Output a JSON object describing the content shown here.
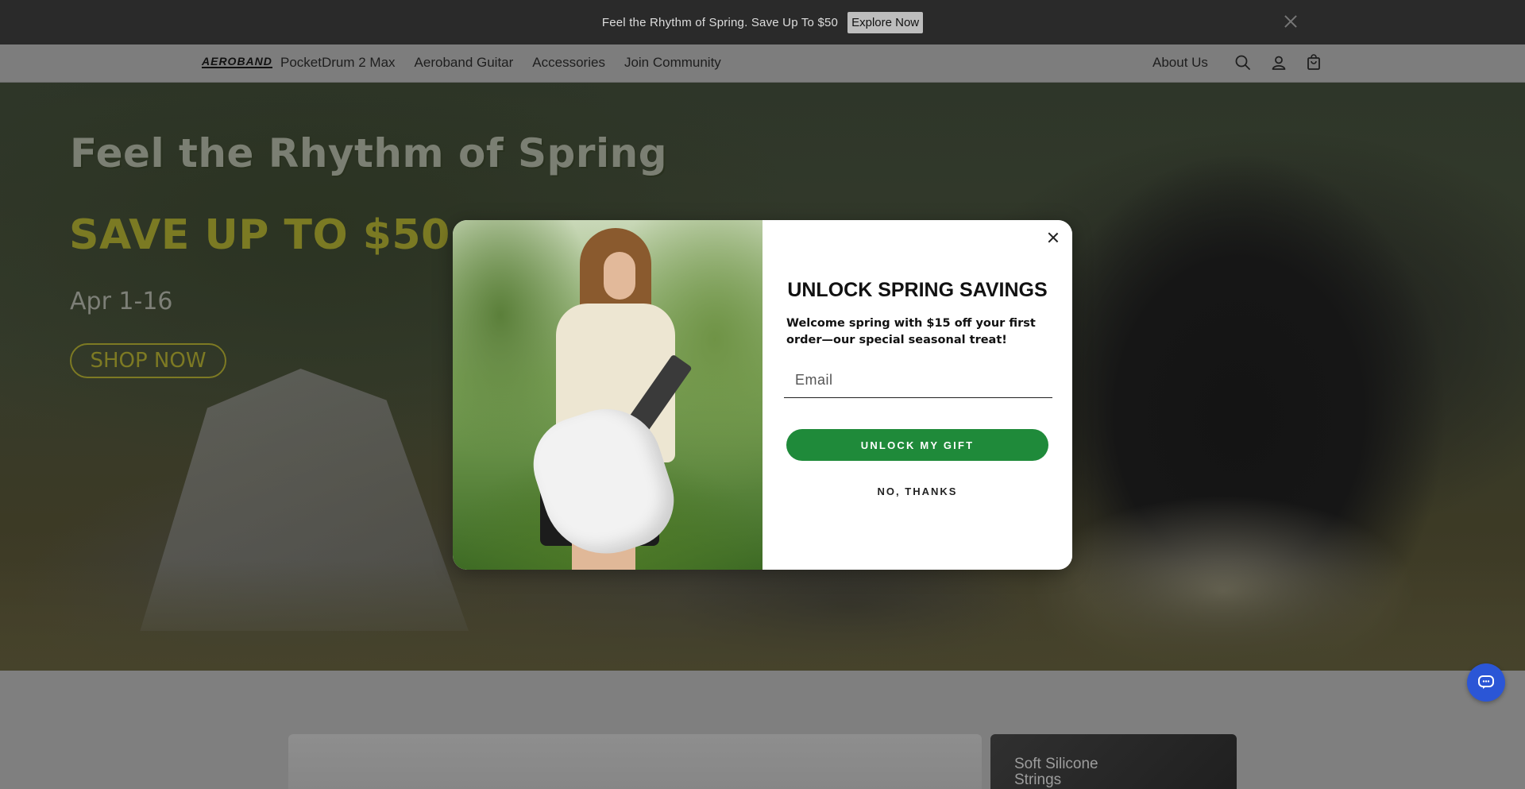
{
  "announcement": {
    "message": "Feel the Rhythm of Spring. Save Up To $50",
    "button_label": "Explore Now"
  },
  "header": {
    "logo": "AEROBAND",
    "nav": [
      "PocketDrum 2 Max",
      "Aeroband Guitar",
      "Accessories",
      "Join Community"
    ],
    "about": "About Us",
    "icons": [
      "search-icon",
      "account-icon",
      "cart-icon"
    ]
  },
  "hero": {
    "title": "Feel the Rhythm of Spring",
    "headline": "SAVE UP TO $50",
    "dates": "Apr 1-16",
    "cta": "SHOP NOW"
  },
  "below": {
    "card_label": "Soft Silicone Strings"
  },
  "modal": {
    "title": "UNLOCK SPRING SAVINGS",
    "description": "Welcome spring with $15 off your first order—our special seasonal treat!",
    "email_placeholder": "Email",
    "submit_label": "UNLOCK MY GIFT",
    "decline_label": "NO, THANKS"
  },
  "colors": {
    "accent_green": "#1f8a3a",
    "chat_blue": "#2b56d6"
  }
}
